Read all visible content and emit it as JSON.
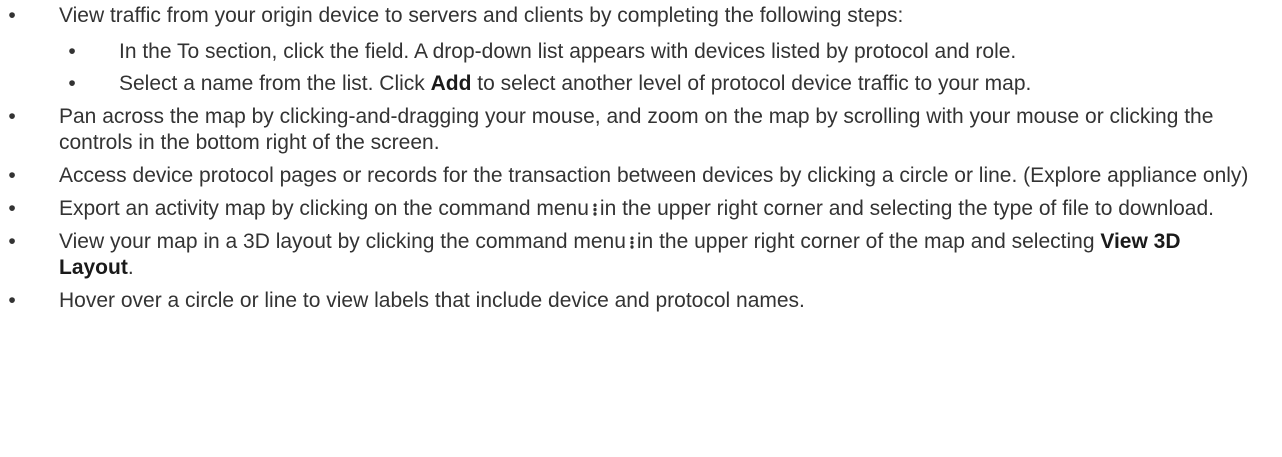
{
  "bullets": {
    "glyph": "•"
  },
  "items": [
    {
      "text": "View traffic from your origin device to servers and clients by completing the following steps:",
      "subitems": [
        {
          "text": "In the To section, click the field. A drop-down list appears with devices listed by protocol and role."
        },
        {
          "before": "Select a name from the list. Click ",
          "bold": "Add",
          "after": " to select another level of protocol device traffic to your map."
        }
      ]
    },
    {
      "text": "Pan across the map by clicking-and-dragging your mouse, and zoom on the map by scrolling with your mouse or clicking the controls in the bottom right of the screen."
    },
    {
      "text": "Access device protocol pages or records for the transaction between devices by clicking a circle or line. (Explore appliance only)"
    },
    {
      "before": "Export an activity map by clicking on the command menu",
      "icon": "command-menu-icon",
      "after": "in the upper right corner and selecting the type of file to download."
    },
    {
      "before": "View your map in a 3D layout by clicking the command menu",
      "icon": "command-menu-icon",
      "middle": "in the upper right corner of the map and selecting ",
      "bold": "View 3D Layout",
      "after": "."
    },
    {
      "text": "Hover over a circle or line to view labels that include device and protocol names."
    }
  ]
}
